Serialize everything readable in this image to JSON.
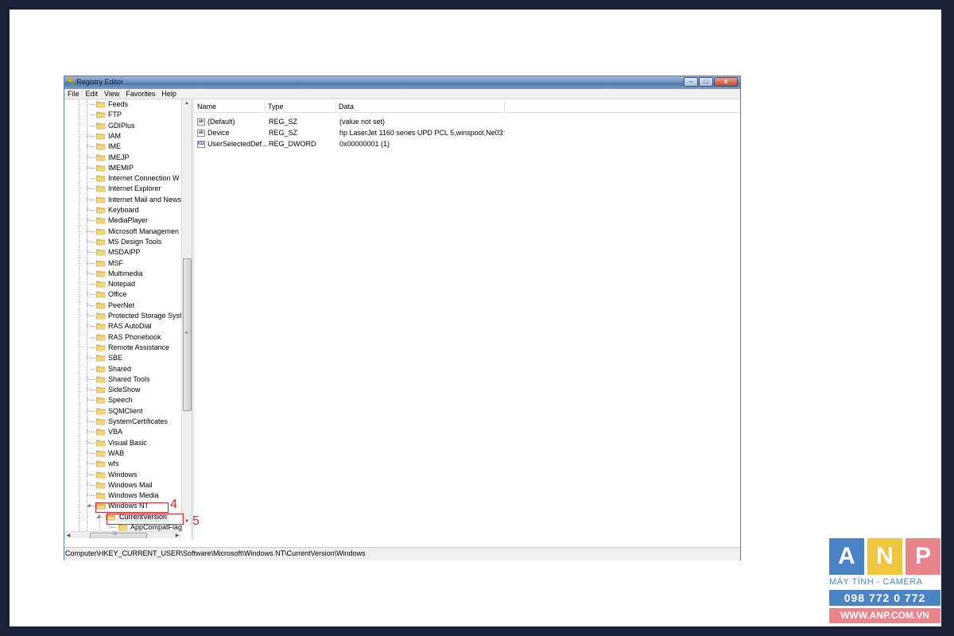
{
  "window": {
    "title": "Registry Editor",
    "minimize_glyph": "–",
    "maximize_glyph": "□",
    "close_glyph": "x"
  },
  "menu": [
    "File",
    "Edit",
    "View",
    "Favorites",
    "Help"
  ],
  "tree": {
    "items": [
      {
        "label": "Feeds",
        "expandable": false
      },
      {
        "label": "FTP",
        "expandable": false
      },
      {
        "label": "GDIPlus",
        "expandable": false
      },
      {
        "label": "IAM",
        "expandable": true
      },
      {
        "label": "IME",
        "expandable": true
      },
      {
        "label": "IMEJP",
        "expandable": true
      },
      {
        "label": "IMEMIP",
        "expandable": true
      },
      {
        "label": "Internet Connection W",
        "expandable": false
      },
      {
        "label": "Internet Explorer",
        "expandable": true
      },
      {
        "label": "Internet Mail and News",
        "expandable": true
      },
      {
        "label": "Keyboard",
        "expandable": true
      },
      {
        "label": "MediaPlayer",
        "expandable": true
      },
      {
        "label": "Microsoft Managemen",
        "expandable": true
      },
      {
        "label": "MS Design Tools",
        "expandable": true
      },
      {
        "label": "MSDAIPP",
        "expandable": true
      },
      {
        "label": "MSF",
        "expandable": true
      },
      {
        "label": "Multimedia",
        "expandable": true
      },
      {
        "label": "Notepad",
        "expandable": false
      },
      {
        "label": "Office",
        "expandable": true
      },
      {
        "label": "PeerNet",
        "expandable": true
      },
      {
        "label": "Protected Storage Syste",
        "expandable": true
      },
      {
        "label": "RAS AutoDial",
        "expandable": true
      },
      {
        "label": "RAS Phonebook",
        "expandable": false
      },
      {
        "label": "Remote Assistance",
        "expandable": false
      },
      {
        "label": "SBE",
        "expandable": true
      },
      {
        "label": "Shared",
        "expandable": false
      },
      {
        "label": "Shared Tools",
        "expandable": true
      },
      {
        "label": "SideShow",
        "expandable": true
      },
      {
        "label": "Speech",
        "expandable": true
      },
      {
        "label": "SQMClient",
        "expandable": true
      },
      {
        "label": "SystemCertificates",
        "expandable": true
      },
      {
        "label": "VBA",
        "expandable": true
      },
      {
        "label": "Visual Basic",
        "expandable": true
      },
      {
        "label": "WAB",
        "expandable": true
      },
      {
        "label": "wfs",
        "expandable": true
      },
      {
        "label": "Windows",
        "expandable": true
      },
      {
        "label": "Windows Mail",
        "expandable": true
      },
      {
        "label": "Windows Media",
        "expandable": true
      },
      {
        "label": "Windows NT",
        "expandable": true,
        "expanded": true,
        "depth": 0
      },
      {
        "label": "CurrentVersion",
        "expandable": true,
        "expanded": true,
        "depth": 1,
        "selected": true
      },
      {
        "label": "AppCompatFlag",
        "expandable": true,
        "depth": 2
      }
    ]
  },
  "scroll": {
    "up_glyph": "▲",
    "down_glyph": "▼",
    "left_glyph": "◀",
    "right_glyph": "▶",
    "thumb_grip": "≡",
    "hthumb_grip": "III"
  },
  "values": {
    "columns": [
      "Name",
      "Type",
      "Data"
    ],
    "rows": [
      {
        "icon": "ab",
        "name": "(Default)",
        "type": "REG_SZ",
        "data": "(value not set)"
      },
      {
        "icon": "ab",
        "name": "Device",
        "type": "REG_SZ",
        "data": "hp LaserJet 1160 series UPD PCL 5,winspool,Ne03:"
      },
      {
        "icon": "011",
        "name": "UserSelectedDef...",
        "type": "REG_DWORD",
        "data": "0x00000001 (1)"
      }
    ]
  },
  "status": "Computer\\HKEY_CURRENT_USER\\Software\\Microsoft\\Windows NT\\CurrentVersion\\Windows",
  "annotations": {
    "step4": "4",
    "step5": "5",
    "color": "#d9252a"
  },
  "logo": {
    "letters": [
      "A",
      "N",
      "P"
    ],
    "tile_colors": [
      "#4a84c4",
      "#f0c640",
      "#e8848a"
    ],
    "tagline": "MÁY TÍNH - CAMERA",
    "phone": "098 772 0 772",
    "website": "WWW.ANP.COM.VN"
  }
}
